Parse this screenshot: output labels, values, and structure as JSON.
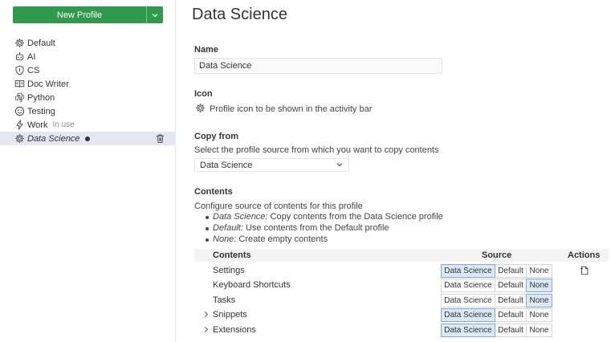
{
  "sidebar": {
    "new_profile_label": "New Profile",
    "profiles": [
      {
        "icon": "gear-icon",
        "name": "Default",
        "in_use": ""
      },
      {
        "icon": "robot-icon",
        "name": "AI",
        "in_use": ""
      },
      {
        "icon": "shield-icon",
        "name": "CS",
        "in_use": ""
      },
      {
        "icon": "book-icon",
        "name": "Doc Writer",
        "in_use": ""
      },
      {
        "icon": "python-icon",
        "name": "Python",
        "in_use": ""
      },
      {
        "icon": "smiley-icon",
        "name": "Testing",
        "in_use": ""
      },
      {
        "icon": "lightning-icon",
        "name": "Work",
        "in_use": "In use"
      },
      {
        "icon": "gear-icon",
        "name": "Data Science",
        "in_use": "",
        "selected": true
      }
    ]
  },
  "main": {
    "title": "Data Science",
    "name_label": "Name",
    "name_value": "Data Science",
    "icon_label": "Icon",
    "icon_desc": "Profile icon to be shown in the activity bar",
    "copy_label": "Copy from",
    "copy_desc": "Select the profile source from which you want to copy contents",
    "copy_value": "Data Science",
    "contents_label": "Contents",
    "contents_desc": "Configure source of contents for this profile",
    "bullets": [
      {
        "em": "Data Science:",
        "text": " Copy contents from the Data Science profile"
      },
      {
        "em": "Default:",
        "text": " Use contents from the Default profile"
      },
      {
        "em": "None:",
        "text": " Create empty contents"
      }
    ],
    "table": {
      "col_contents": "Contents",
      "col_source": "Source",
      "col_actions": "Actions",
      "options": [
        "Data Science",
        "Default",
        "None"
      ],
      "rows": [
        {
          "label": "Settings",
          "expandable": false,
          "selected": "Data Science",
          "action": true
        },
        {
          "label": "Keyboard Shortcuts",
          "expandable": false,
          "selected": "None",
          "action": false
        },
        {
          "label": "Tasks",
          "expandable": false,
          "selected": "None",
          "action": false
        },
        {
          "label": "Snippets",
          "expandable": true,
          "selected": "Data Science",
          "action": false
        },
        {
          "label": "Extensions",
          "expandable": true,
          "selected": "Data Science",
          "action": false
        }
      ]
    }
  },
  "colors": {
    "accent_green": "#2f9a4b",
    "selected_bg": "#e4e6f1",
    "option_on_bg": "#dbe8f7",
    "option_on_border": "#84a9d6"
  }
}
